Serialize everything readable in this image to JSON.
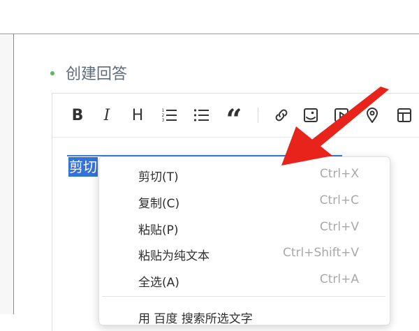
{
  "section": {
    "heading": "创建回答"
  },
  "toolbar": {
    "icons": [
      "bold-icon",
      "italic-icon",
      "heading-icon",
      "ordered-list-icon",
      "unordered-list-icon",
      "quote-icon",
      "link-icon",
      "image-icon",
      "video-icon",
      "location-icon",
      "table-icon"
    ],
    "bold_label": "B",
    "italic_label": "I",
    "heading_label": "H",
    "quote_label": "“"
  },
  "editor": {
    "selected_text": "剪切"
  },
  "context_menu": {
    "items": [
      {
        "label": "剪切(T)",
        "shortcut": "Ctrl+X"
      },
      {
        "label": "复制(C)",
        "shortcut": "Ctrl+C"
      },
      {
        "label": "粘贴(P)",
        "shortcut": "Ctrl+V"
      },
      {
        "label": "粘贴为纯文本",
        "shortcut": "Ctrl+Shift+V"
      },
      {
        "label": "全选(A)",
        "shortcut": "Ctrl+A"
      },
      {
        "label": "用 百度 搜索所选文字",
        "shortcut": ""
      }
    ]
  },
  "colors": {
    "accent": "#3471d8",
    "bullet": "#5cb85c",
    "arrow": "#e8231c"
  }
}
